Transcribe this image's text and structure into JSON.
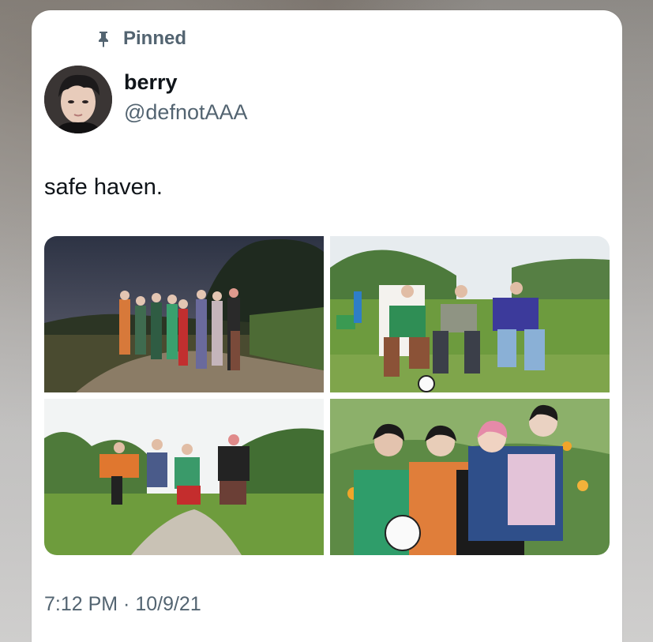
{
  "tweet": {
    "pinned_label": "Pinned",
    "author": {
      "display_name": "berry",
      "handle": "@defnotAAA"
    },
    "text": "safe haven.",
    "timestamp": "7:12 PM · 10/9/21",
    "photos": [
      {
        "label": "photo-1"
      },
      {
        "label": "photo-2"
      },
      {
        "label": "photo-3"
      },
      {
        "label": "photo-4"
      }
    ]
  },
  "colors": {
    "primary_text": "#0f1419",
    "secondary_text": "#536471",
    "card_background": "#ffffff"
  },
  "icons": {
    "pin": "pin-icon"
  }
}
